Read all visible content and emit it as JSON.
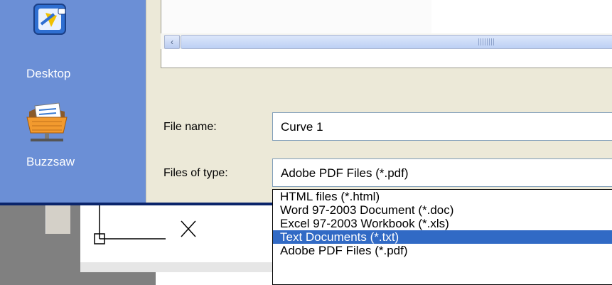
{
  "places_bar": {
    "items": [
      {
        "label": "Desktop",
        "icon": "desktop-icon"
      },
      {
        "label": "Buzzsaw",
        "icon": "buzzsaw-icon"
      }
    ]
  },
  "file_list": {
    "scroll_left_glyph": "‹"
  },
  "form": {
    "file_name_label": "File name:",
    "file_name_value": "Curve 1",
    "file_type_label": "Files of type:",
    "file_type_value": "Adobe PDF Files (*.pdf)"
  },
  "dropdown": {
    "options": [
      {
        "label": "HTML files (*.html)",
        "selected": false
      },
      {
        "label": "Word 97-2003 Document (*.doc)",
        "selected": false
      },
      {
        "label": "Excel 97-2003 Workbook (*.xls)",
        "selected": false
      },
      {
        "label": "Text Documents (*.txt)",
        "selected": true
      },
      {
        "label": "Adobe PDF Files (*.pdf)",
        "selected": false
      }
    ]
  },
  "colors": {
    "places_bar": "#6b8fd6",
    "selection": "#316ac5",
    "dialog_bg": "#ece9d8"
  }
}
